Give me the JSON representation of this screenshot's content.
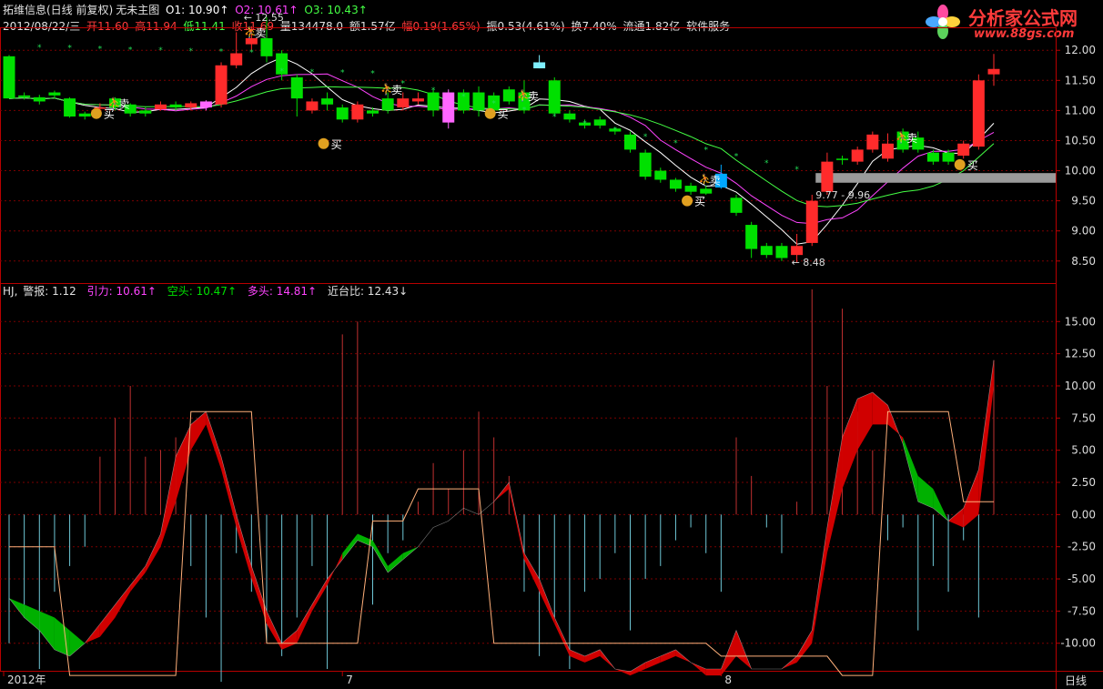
{
  "header": {
    "title": "拓维信息(日线 前复权)",
    "subtitle": "无未主图",
    "o1": "O1: 10.90↑",
    "o2": "O2: 10.61↑",
    "o3": "O3: 10.43↑",
    "date": "2012/08/22/三",
    "open": "开11.60",
    "high": "高11.94",
    "low": "低11.41",
    "close": "收11.69",
    "volume": "量134478.0",
    "amount": "额1.57亿",
    "amp": "幅0.19(1.65%)",
    "swing": "振0.53(4.61%)",
    "turnover": "换7.40%",
    "float": "流通1.82亿",
    "service": "软件服务"
  },
  "logo": {
    "name": "分析家公式网",
    "url": "www.88gs.com"
  },
  "main_labels": {
    "high_mark": "12.55",
    "low_mark": "8.48",
    "band": "9.77 - 9.96",
    "buy": "买",
    "sell": "卖"
  },
  "indicator_header": {
    "name": "HJ,",
    "alarm": "警报: 1.12",
    "pull": "引力: 10.61↑",
    "short": "空头: 10.47↑",
    "long": "多头: 14.81↑",
    "ratio": "近台比: 12.43↓"
  },
  "axis": {
    "price_ticks": [
      "12.00",
      "11.50",
      "11.00",
      "10.50",
      "10.00",
      "9.50",
      "9.00",
      "8.50"
    ],
    "ind_ticks": [
      "15.00",
      "12.50",
      "10.00",
      "7.50",
      "5.00",
      "2.50",
      "0.00",
      "-2.50",
      "-5.00",
      "-7.50",
      "-10.00"
    ],
    "date_ticks": [
      "2012年",
      "7",
      "8"
    ],
    "period": "日线"
  },
  "colors": {
    "up": "#ff2b2b",
    "down": "#00e000",
    "grid": "#7a0000",
    "frame": "#b80000",
    "ma1": "#ffffff",
    "ma2": "#ff44ff",
    "ma3": "#44ff44",
    "ind_red": "#d00000",
    "ind_green": "#00b000",
    "ind_line": "#ffb07a",
    "vbar_up": "#c03030",
    "vbar_down": "#6fc7d6"
  },
  "chart_data": [
    {
      "type": "candlestick",
      "ylim": [
        8.3,
        12.2
      ],
      "candles": [
        [
          11.9,
          11.2,
          11.92,
          11.2
        ],
        [
          11.25,
          11.22,
          11.3,
          11.18
        ],
        [
          11.22,
          11.15,
          11.26,
          11.1
        ],
        [
          11.3,
          11.25,
          11.33,
          11.2
        ],
        [
          11.2,
          10.9,
          11.22,
          10.88
        ],
        [
          10.95,
          10.9,
          10.98,
          10.85
        ],
        [
          11.05,
          11.05,
          11.12,
          11.0
        ],
        [
          11.2,
          11.05,
          11.22,
          11.0
        ],
        [
          11.1,
          10.95,
          11.12,
          10.9
        ],
        [
          11.0,
          10.95,
          11.05,
          10.9
        ],
        [
          11.02,
          11.1,
          11.15,
          11.0
        ],
        [
          11.1,
          11.05,
          11.15,
          11.0
        ],
        [
          11.05,
          11.12,
          11.15,
          11.0
        ],
        [
          11.15,
          11.05,
          11.17,
          11.0
        ],
        [
          11.1,
          11.75,
          11.8,
          11.05
        ],
        [
          11.75,
          11.95,
          12.3,
          11.7
        ],
        [
          12.1,
          12.2,
          12.4,
          12.0
        ],
        [
          12.2,
          11.9,
          12.55,
          11.8
        ],
        [
          11.95,
          11.6,
          12.0,
          11.5
        ],
        [
          11.55,
          11.2,
          11.6,
          10.9
        ],
        [
          11.0,
          11.15,
          11.2,
          10.95
        ],
        [
          11.2,
          11.1,
          11.3,
          11.0
        ],
        [
          11.05,
          10.85,
          11.1,
          10.8
        ],
        [
          10.85,
          11.1,
          11.15,
          10.8
        ],
        [
          11.0,
          10.95,
          11.05,
          10.9
        ],
        [
          11.2,
          11.0,
          11.3,
          10.95
        ],
        [
          11.05,
          11.2,
          11.3,
          11.0
        ],
        [
          11.15,
          11.2,
          11.3,
          11.1
        ],
        [
          11.3,
          11.0,
          11.35,
          10.9
        ],
        [
          11.3,
          10.8,
          11.35,
          10.7
        ],
        [
          11.3,
          11.0,
          11.35,
          10.95
        ],
        [
          11.3,
          11.0,
          11.4,
          10.9
        ],
        [
          11.25,
          11.0,
          11.3,
          10.95
        ],
        [
          11.35,
          11.15,
          11.4,
          11.1
        ],
        [
          11.3,
          11.0,
          11.5,
          10.95
        ],
        [
          11.7,
          11.8,
          11.92,
          11.7
        ],
        [
          11.5,
          10.95,
          11.55,
          10.9
        ],
        [
          10.95,
          10.85,
          11.0,
          10.8
        ],
        [
          10.8,
          10.75,
          10.85,
          10.7
        ],
        [
          10.85,
          10.75,
          10.9,
          10.7
        ],
        [
          10.7,
          10.65,
          10.72,
          10.6
        ],
        [
          10.6,
          10.35,
          10.65,
          10.3
        ],
        [
          10.3,
          9.9,
          10.35,
          9.85
        ],
        [
          10.0,
          9.85,
          10.05,
          9.8
        ],
        [
          9.85,
          9.7,
          9.88,
          9.65
        ],
        [
          9.75,
          9.65,
          9.8,
          9.6
        ],
        [
          9.7,
          9.62,
          9.75,
          9.6
        ],
        [
          9.72,
          9.95,
          10.1,
          9.7
        ],
        [
          9.55,
          9.3,
          9.6,
          9.25
        ],
        [
          9.1,
          8.7,
          9.15,
          8.55
        ],
        [
          8.75,
          8.6,
          8.8,
          8.55
        ],
        [
          8.75,
          8.55,
          8.8,
          8.5
        ],
        [
          8.6,
          8.75,
          8.95,
          8.48
        ],
        [
          8.8,
          9.5,
          9.6,
          8.75
        ],
        [
          9.65,
          10.15,
          10.3,
          9.6
        ],
        [
          10.2,
          10.18,
          10.25,
          10.1
        ],
        [
          10.15,
          10.35,
          10.4,
          10.1
        ],
        [
          10.35,
          10.6,
          10.65,
          10.3
        ],
        [
          10.2,
          10.45,
          10.62,
          10.15
        ],
        [
          10.65,
          10.35,
          10.7,
          10.3
        ],
        [
          10.55,
          10.35,
          10.65,
          10.3
        ],
        [
          10.3,
          10.15,
          10.35,
          10.1
        ],
        [
          10.3,
          10.15,
          10.35,
          10.1
        ],
        [
          10.25,
          10.45,
          10.5,
          10.2
        ],
        [
          10.4,
          11.5,
          11.6,
          10.35
        ],
        [
          11.6,
          11.69,
          11.94,
          11.41
        ]
      ]
    },
    {
      "type": "area",
      "ylim": [
        -12.0,
        17.0
      ],
      "x": [
        0,
        1,
        2,
        3,
        4,
        5,
        6,
        7,
        8,
        9,
        10,
        11,
        12,
        13,
        14,
        15,
        16,
        17,
        18,
        19,
        20,
        21,
        22,
        23,
        24,
        25,
        26,
        27,
        28,
        29,
        30,
        31,
        32,
        33,
        34,
        35,
        36,
        37,
        38,
        39,
        40,
        41,
        42,
        43,
        44,
        45,
        46,
        47,
        48,
        49,
        50,
        51,
        52,
        53,
        54,
        55,
        56,
        57,
        58,
        59,
        60,
        61,
        62,
        63,
        64,
        65
      ],
      "series": [
        {
          "values": [
            -6.5,
            -8,
            -9,
            -10.5,
            -11,
            -10,
            -8.5,
            -7,
            -5.5,
            -4,
            -1.5,
            4.5,
            7,
            8,
            4.5,
            0,
            -4,
            -7.5,
            -10,
            -9,
            -7,
            -5,
            -3.5,
            -2,
            -2.5,
            -4.5,
            -3.5,
            -2.5,
            -1,
            -0.5,
            0.5,
            0,
            1,
            2.5,
            -3,
            -5,
            -8,
            -10.5,
            -11,
            -10.5,
            -12,
            -12.2,
            -11.5,
            -11,
            -10.5,
            -11.5,
            -12,
            -12,
            -9,
            -12,
            -12,
            -12,
            -11,
            -9,
            -1,
            6,
            9,
            9.5,
            8.5,
            5.5,
            1,
            0.5,
            -0.5,
            0.5,
            3.5,
            12
          ]
        },
        {
          "values": [
            -6.5,
            -7,
            -7.5,
            -8,
            -9,
            -10,
            -9.5,
            -8,
            -6,
            -4.5,
            -2.5,
            1,
            5,
            7,
            3.5,
            -1,
            -5,
            -8.5,
            -10.5,
            -10,
            -7.5,
            -5.5,
            -3,
            -1.5,
            -2,
            -4,
            -3,
            -2.5,
            -1,
            -0.5,
            0.5,
            0,
            1,
            2,
            -3.5,
            -6,
            -8.5,
            -11,
            -11.5,
            -11,
            -12,
            -12.5,
            -12,
            -11.5,
            -11,
            -11.5,
            -12.5,
            -12.5,
            -11,
            -12,
            -12,
            -12,
            -11.5,
            -10,
            -3,
            2,
            5,
            7,
            7,
            6,
            3,
            2,
            -0.5,
            -1,
            0,
            10
          ]
        },
        {
          "values": [
            -2.5,
            -2.5,
            -2.5,
            -2.5,
            -12.5,
            -12.5,
            -12.5,
            -12.5,
            -12.5,
            -12.5,
            -12.5,
            -12.5,
            8,
            8,
            8,
            8,
            8,
            -10,
            -10,
            -10,
            -10,
            -10,
            -10,
            -10,
            -0.5,
            -0.5,
            -0.5,
            2,
            2,
            2,
            2,
            2,
            -10,
            -10,
            -10,
            -10,
            -10,
            -10,
            -10,
            -10,
            -10,
            -10,
            -10,
            -10,
            -10,
            -10,
            -10,
            -11,
            -11,
            -11,
            -11,
            -11,
            -11,
            -11,
            -11,
            -12.5,
            -12.5,
            -12.5,
            8,
            8,
            8,
            8,
            8,
            1,
            1,
            1
          ]
        }
      ],
      "bars": [
        {
          "x": 0,
          "v": -10
        },
        {
          "x": 1,
          "v": -8
        },
        {
          "x": 2,
          "v": -12
        },
        {
          "x": 3,
          "v": -6
        },
        {
          "x": 4,
          "v": -4
        },
        {
          "x": 5,
          "v": -2.5
        },
        {
          "x": 6,
          "v": 4.5
        },
        {
          "x": 7,
          "v": 7.5
        },
        {
          "x": 8,
          "v": 10
        },
        {
          "x": 9,
          "v": 4.5
        },
        {
          "x": 10,
          "v": 5
        },
        {
          "x": 11,
          "v": 6
        },
        {
          "x": 12,
          "v": -4
        },
        {
          "x": 13,
          "v": -8
        },
        {
          "x": 14,
          "v": -13
        },
        {
          "x": 15,
          "v": -3
        },
        {
          "x": 16,
          "v": -6
        },
        {
          "x": 17,
          "v": -10
        },
        {
          "x": 18,
          "v": -11
        },
        {
          "x": 19,
          "v": -8
        },
        {
          "x": 20,
          "v": -4
        },
        {
          "x": 21,
          "v": -12
        },
        {
          "x": 22,
          "v": 14
        },
        {
          "x": 23,
          "v": 15
        },
        {
          "x": 24,
          "v": -7
        },
        {
          "x": 25,
          "v": -3
        },
        {
          "x": 26,
          "v": -2
        },
        {
          "x": 27,
          "v": 1
        },
        {
          "x": 28,
          "v": 4
        },
        {
          "x": 29,
          "v": 2
        },
        {
          "x": 30,
          "v": 5
        },
        {
          "x": 31,
          "v": 8
        },
        {
          "x": 32,
          "v": 6
        },
        {
          "x": 33,
          "v": 3
        },
        {
          "x": 34,
          "v": -6
        },
        {
          "x": 35,
          "v": -11
        },
        {
          "x": 36,
          "v": -8
        },
        {
          "x": 37,
          "v": -12
        },
        {
          "x": 38,
          "v": -6
        },
        {
          "x": 39,
          "v": -5
        },
        {
          "x": 40,
          "v": -3
        },
        {
          "x": 41,
          "v": -9
        },
        {
          "x": 42,
          "v": -5
        },
        {
          "x": 43,
          "v": -4
        },
        {
          "x": 44,
          "v": -2
        },
        {
          "x": 45,
          "v": -1
        },
        {
          "x": 46,
          "v": -3
        },
        {
          "x": 47,
          "v": -6
        },
        {
          "x": 48,
          "v": 6
        },
        {
          "x": 49,
          "v": 3
        },
        {
          "x": 50,
          "v": -1
        },
        {
          "x": 51,
          "v": -3
        },
        {
          "x": 52,
          "v": 1
        },
        {
          "x": 53,
          "v": 17.5
        },
        {
          "x": 54,
          "v": 10
        },
        {
          "x": 55,
          "v": 16
        },
        {
          "x": 56,
          "v": 8
        },
        {
          "x": 57,
          "v": 5
        },
        {
          "x": 58,
          "v": -2
        },
        {
          "x": 59,
          "v": -1
        },
        {
          "x": 60,
          "v": -9
        },
        {
          "x": 61,
          "v": -4
        },
        {
          "x": 62,
          "v": -6
        },
        {
          "x": 63,
          "v": -2
        },
        {
          "x": 64,
          "v": -8
        },
        {
          "x": 65,
          "v": 12
        }
      ]
    }
  ]
}
